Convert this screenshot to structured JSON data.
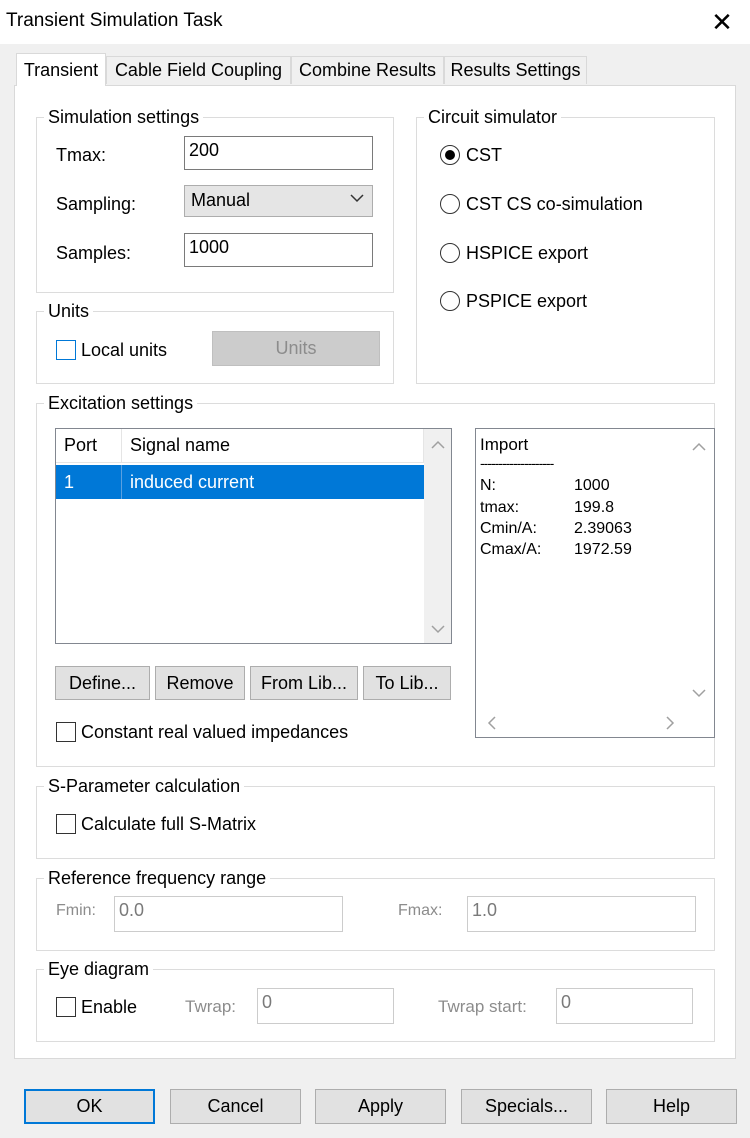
{
  "window": {
    "title": "Transient Simulation Task",
    "close_glyph": "✕"
  },
  "tabs": [
    {
      "label": "Transient",
      "active": true
    },
    {
      "label": "Cable Field Coupling"
    },
    {
      "label": "Combine Results"
    },
    {
      "label": "Results Settings"
    }
  ],
  "simulation_settings": {
    "legend": "Simulation settings",
    "tmax_label": "Tmax:",
    "tmax_value": "200",
    "sampling_label": "Sampling:",
    "sampling_value": "Manual",
    "samples_label": "Samples:",
    "samples_value": "1000"
  },
  "circuit_simulator": {
    "legend": "Circuit simulator",
    "options": [
      "CST",
      "CST CS co-simulation",
      "HSPICE export",
      "PSPICE export"
    ],
    "selected": "CST"
  },
  "units": {
    "legend": "Units",
    "local_units_label": "Local units",
    "local_units_checked": false,
    "units_button": "Units"
  },
  "excitation": {
    "legend": "Excitation settings",
    "columns": [
      "Port",
      "Signal name"
    ],
    "rows": [
      {
        "port": "1",
        "signal": "induced current",
        "selected": true
      }
    ],
    "buttons": [
      "Define...",
      "Remove",
      "From Lib...",
      "To Lib..."
    ],
    "constant_impedances_label": "Constant real valued impedances",
    "constant_impedances_checked": false,
    "import": {
      "title": "Import",
      "separator": "--------------------",
      "lines": [
        {
          "key": "N:",
          "value": "1000"
        },
        {
          "key": "tmax:",
          "value": "199.8"
        },
        {
          "key": "Cmin/A:",
          "value": "2.39063"
        },
        {
          "key": "Cmax/A:",
          "value": "1972.59"
        }
      ]
    }
  },
  "sparam": {
    "legend": "S-Parameter calculation",
    "full_matrix_label": "Calculate full S-Matrix",
    "full_matrix_checked": false
  },
  "ref_freq": {
    "legend": "Reference frequency range",
    "fmin_label": "Fmin:",
    "fmin_value": "0.0",
    "fmax_label": "Fmax:",
    "fmax_value": "1.0"
  },
  "eye": {
    "legend": "Eye diagram",
    "enable_label": "Enable",
    "enable_checked": false,
    "twrap_label": "Twrap:",
    "twrap_value": "0",
    "twrap_start_label": "Twrap start:",
    "twrap_start_value": "0"
  },
  "footer": {
    "ok": "OK",
    "cancel": "Cancel",
    "apply": "Apply",
    "specials": "Specials...",
    "help": "Help"
  },
  "icons": {
    "dropdown": "chevron-down-icon",
    "close": "close-icon"
  }
}
